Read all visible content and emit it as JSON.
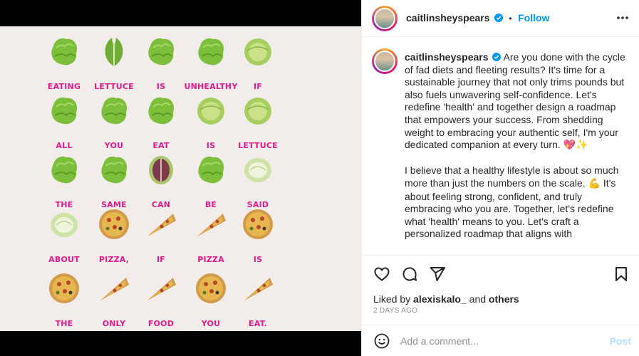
{
  "post": {
    "username": "caitlinsheyspears",
    "follow_label": "Follow",
    "separator": "•",
    "more_label": "•••"
  },
  "image": {
    "words": [
      "EATING",
      "LETTUCE",
      "IS",
      "UNHEALTHY",
      "IF",
      "ALL",
      "YOU",
      "EAT",
      "IS",
      "LETTUCE",
      "THE",
      "SAME",
      "CAN",
      "BE",
      "SAID",
      "ABOUT",
      "PIZZA,",
      "IF",
      "PIZZA",
      "IS",
      "THE",
      "ONLY",
      "FOOD",
      "YOU",
      "EAT."
    ],
    "pictures": [
      "lettuce",
      "romaine",
      "lettuce-leaf",
      "lettuce",
      "iceberg",
      "lettuce-head",
      "lettuce-leaf",
      "lettuce",
      "iceberg",
      "iceberg",
      "lettuce",
      "lettuce-leaf",
      "radicchio",
      "butter-lettuce",
      "cabbage-half",
      "cabbage-half",
      "pizza-whole",
      "pizza-slice",
      "pizza-slice",
      "pizza-whole",
      "pizza-whole",
      "pizza-slice",
      "pizza-slice",
      "pizza-whole",
      "pizza-slice"
    ]
  },
  "caption": {
    "username": "caitlinsheyspears",
    "paragraph1": "Are you done with the cycle of fad diets and fleeting results? It's time for a sustainable journey that not only trims pounds but also fuels unwavering self-confidence. Let's redefine 'health' and together design a roadmap that empowers your success. From shedding weight to embracing your authentic self, I'm your dedicated companion at every turn.",
    "paragraph1_emoji": "💖✨",
    "paragraph2a": "I believe that a healthy lifestyle is about so much more than just the numbers on the scale.",
    "paragraph2_emoji": "💪",
    "paragraph2b": "It's about feeling strong, confident, and truly embracing who you are. Together, let's redefine what 'health' means to you. Let's craft a personalized roadmap that aligns with"
  },
  "engagement": {
    "liked_prefix": "Liked by",
    "liked_user": "alexiskalo_",
    "liked_and": "and",
    "liked_others": "others",
    "time_ago": "2 DAYS AGO"
  },
  "comment": {
    "placeholder": "Add a comment...",
    "post_label": "Post"
  },
  "colors": {
    "word_pink": "#e01c8c",
    "link_blue": "#0095f6",
    "background": "#f2ecea"
  }
}
